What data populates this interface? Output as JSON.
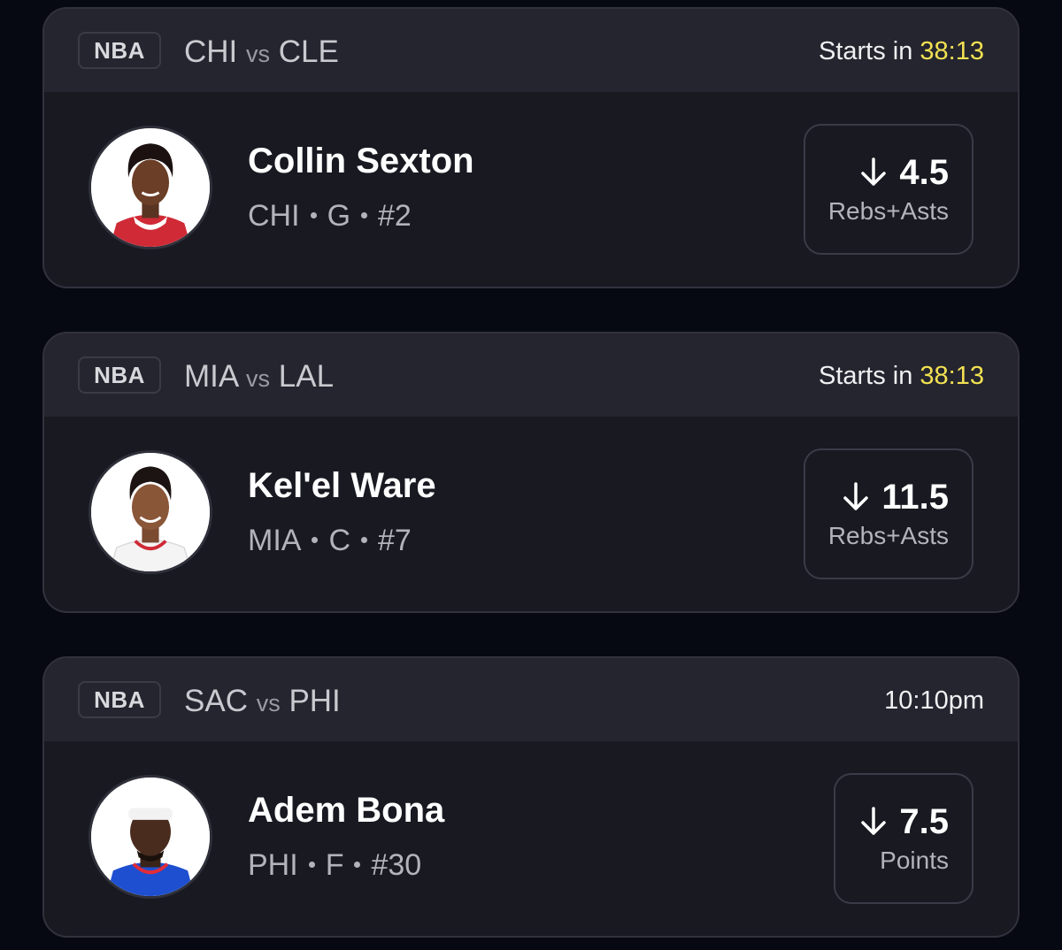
{
  "colors": {
    "background": "#070912",
    "card": "#181921",
    "card_header": "#24252e",
    "countdown_accent": "#f2e052"
  },
  "picks": [
    {
      "league": "NBA",
      "home": "CHI",
      "vs": "vs",
      "away": "CLE",
      "time_label": "Starts in ",
      "time_value": "38:13",
      "player": {
        "name": "Collin Sexton",
        "team": "CHI",
        "position": "G",
        "number": "#2",
        "jersey_color": "#cf2a36"
      },
      "direction_icon": "arrow-down-icon",
      "line": "4.5",
      "stat": "Rebs+Asts"
    },
    {
      "league": "NBA",
      "home": "MIA",
      "vs": "vs",
      "away": "LAL",
      "time_label": "Starts in ",
      "time_value": "38:13",
      "player": {
        "name": "Kel'el Ware",
        "team": "MIA",
        "position": "C",
        "number": "#7",
        "jersey_color": "#f4f4f4"
      },
      "direction_icon": "arrow-down-icon",
      "line": "11.5",
      "stat": "Rebs+Asts"
    },
    {
      "league": "NBA",
      "home": "SAC",
      "vs": "vs",
      "away": "PHI",
      "time_label": "",
      "time_value": "10:10pm",
      "player": {
        "name": "Adem Bona",
        "team": "PHI",
        "position": "F",
        "number": "#30",
        "jersey_color": "#1d4fd0"
      },
      "direction_icon": "arrow-down-icon",
      "line": "7.5",
      "stat": "Points"
    }
  ]
}
